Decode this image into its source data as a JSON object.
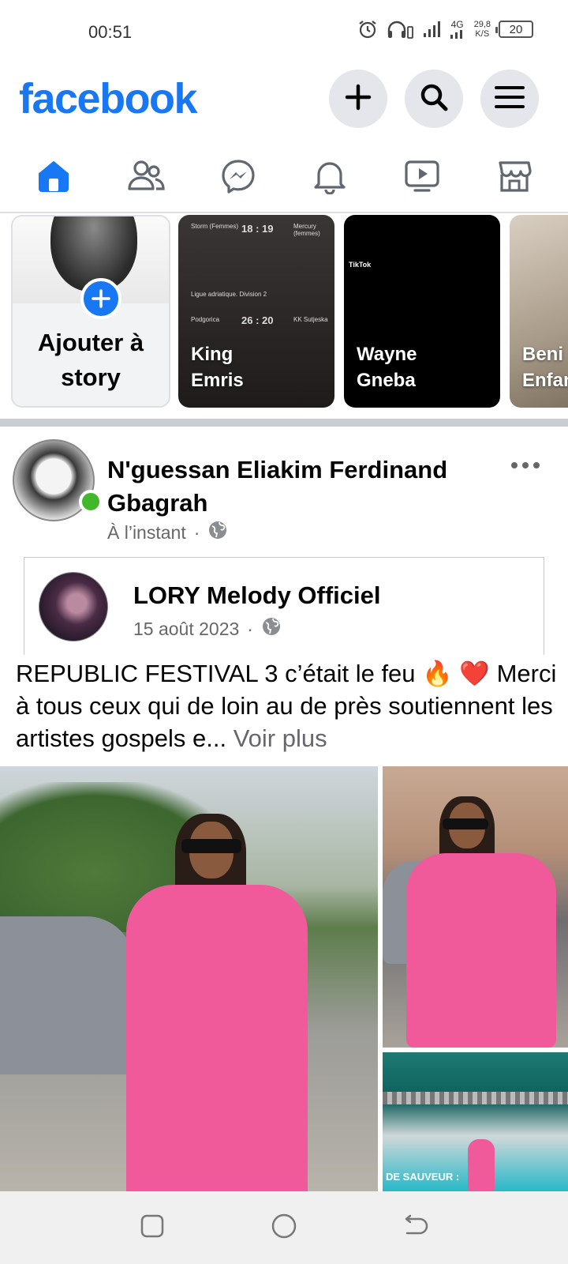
{
  "status_bar": {
    "time": "00:51",
    "network": "4G",
    "speed_value": "29,8",
    "speed_unit": "K/S",
    "battery": "20"
  },
  "header": {
    "logo": "facebook",
    "brand_color": "#1877f2"
  },
  "tabs": [
    {
      "name": "home",
      "icon": "home-icon",
      "active": true
    },
    {
      "name": "friends",
      "icon": "friends-icon"
    },
    {
      "name": "messenger",
      "icon": "messenger-icon"
    },
    {
      "name": "notifications",
      "icon": "bell-icon"
    },
    {
      "name": "video",
      "icon": "video-icon"
    },
    {
      "name": "marketplace",
      "icon": "marketplace-icon"
    }
  ],
  "stories": {
    "create_label": "Ajouter à story",
    "items": [
      {
        "name": "King\nEmris"
      },
      {
        "name": "Wayne\nGneba"
      },
      {
        "name": "Beni\nEnfan"
      }
    ],
    "mini_texts": {
      "team1": "Storm (Femmes)",
      "score1": "18 : 19",
      "team2": "Mercury (femmes)",
      "score2": "26 : 20",
      "team3": "Podgorica",
      "team4": "KK Sutjeska",
      "league": "Ligue adriatique. Division 2",
      "tiktok": "TikTok"
    }
  },
  "post": {
    "author": "N'guessan Eliakim Ferdinand Gbagrah",
    "time": "À l’instant",
    "shared": {
      "author": "LORY Melody Officiel",
      "date": "15 août 2023"
    },
    "caption": "REPUBLIC FESTIVAL 3 c’était le feu 🔥 ❤️ Merci à tous ceux qui de loin au de près soutiennent les artistes gospels e...",
    "see_more": " Voir plus",
    "photo_banner": "DE SAUVEUR :"
  }
}
